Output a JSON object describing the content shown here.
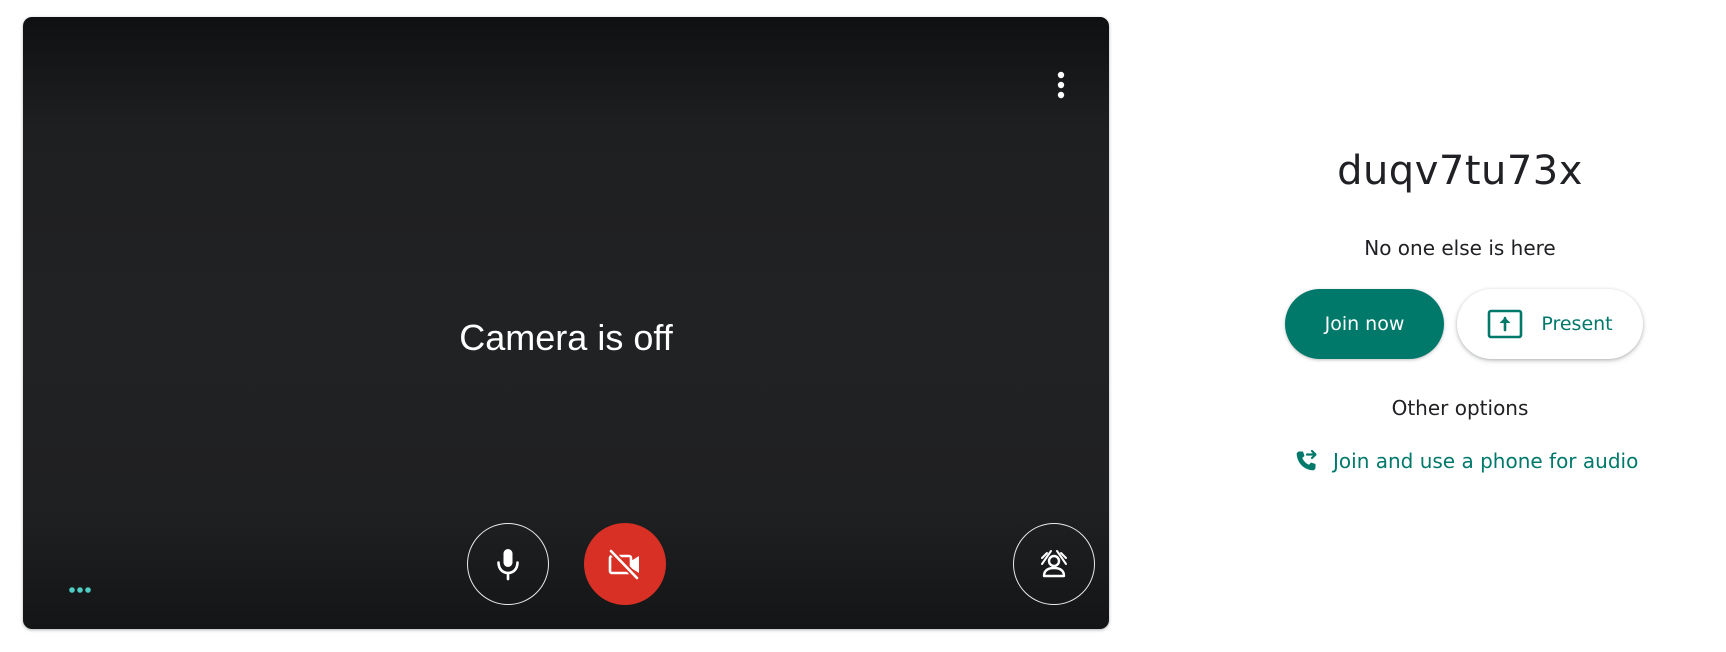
{
  "preview": {
    "camera_status": "Camera is off",
    "icons": {
      "menu": "more-vert-icon",
      "mic": "microphone-icon",
      "camera": "camera-off-icon",
      "effects": "visual-effects-icon",
      "more": "more-horiz-icon"
    },
    "colors": {
      "camera_off_button": "#d93025",
      "more_dots": "#4ecdc4"
    }
  },
  "meeting": {
    "code": "duqv7tu73x",
    "status": "No one else is here",
    "join_label": "Join now",
    "present_label": "Present",
    "other_options_label": "Other options",
    "phone_audio_label": "Join and use a phone for audio"
  },
  "colors": {
    "accent": "#00796b",
    "text": "#202124"
  }
}
